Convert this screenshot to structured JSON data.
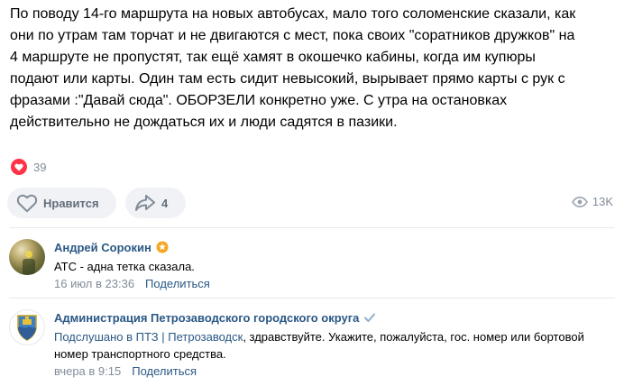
{
  "post": {
    "text": "По поводу 14-го маршрута на новых автобусах, мало того соломенские сказали, как\nони по утрам там торчат и не двигаются с мест, пока своих \"соратников дружков\" на\n4 маршруте не пропустят, так ещё хамят в окошечко кабины, когда им купюры\nподают или карты. Один там есть сидит невысокий, вырывает прямо карты с рук с\nфразами :\"Давай сюда\". ОБОРЗЕЛИ конкретно уже. С утра на остановках\nдействительно не дождаться их и люди садятся в пазики.",
    "reactions_count": "39",
    "reaction_icon": "heart-icon",
    "like_label": "Нравится",
    "share_count": "4",
    "views_count": "13K"
  },
  "comments": [
    {
      "author": "Андрей Сорокин",
      "badge_icon": "star-badge-icon",
      "text": "АТС - адна тетка сказала.",
      "date": "16 июл в 23:36",
      "reply_label": "Поделиться"
    },
    {
      "author": "Администрация Петрозаводского городского округа",
      "badge_icon": "verified-check-icon",
      "reply_to": "Подслушано в ПТЗ | Петрозаводск",
      "text": ", здравствуйте. Укажите, пожалуйста, гос. номер или бортовой номер транспортного средства.",
      "date": "вчера в 9:15",
      "reply_label": "Поделиться"
    }
  ],
  "colors": {
    "link": "#2a5885",
    "secondary": "#818c99",
    "button_bg": "#f0f2f5",
    "heart": "#ff3347",
    "star_badge": "#f5a623",
    "verified": "#8fadc8"
  }
}
